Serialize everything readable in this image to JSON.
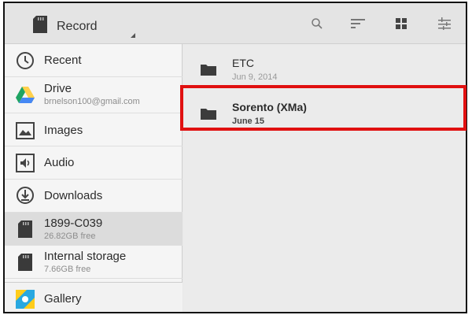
{
  "actionbar": {
    "title": "Record",
    "icons": [
      "sd-card-icon",
      "search-icon",
      "sort-icon",
      "grid-view-icon",
      "settings-sliders-icon"
    ]
  },
  "drawer": {
    "items": [
      {
        "label": "Recent",
        "icon": "clock-icon"
      },
      {
        "label": "Drive",
        "sub": "brnelson100@gmail.com",
        "icon": "drive-icon"
      },
      {
        "label": "Images",
        "icon": "images-icon"
      },
      {
        "label": "Audio",
        "icon": "audio-icon"
      },
      {
        "label": "Downloads",
        "icon": "download-icon"
      },
      {
        "label": "1899-C039",
        "sub": "26.82GB free",
        "icon": "sd-card-icon",
        "selected": true
      },
      {
        "label": "Internal storage",
        "sub": "7.66GB free",
        "icon": "sd-card-icon"
      },
      {
        "label": "Gallery",
        "icon": "gallery-icon"
      }
    ]
  },
  "files": [
    {
      "name": "ETC",
      "date": "Jun 9, 2014"
    },
    {
      "name": "Sorento (XMa)",
      "date": "June 15"
    }
  ],
  "colors": {
    "highlight": "#e01010",
    "drive_green": "#1fa463",
    "drive_yellow": "#ffd04b",
    "drive_blue": "#4688f4"
  }
}
